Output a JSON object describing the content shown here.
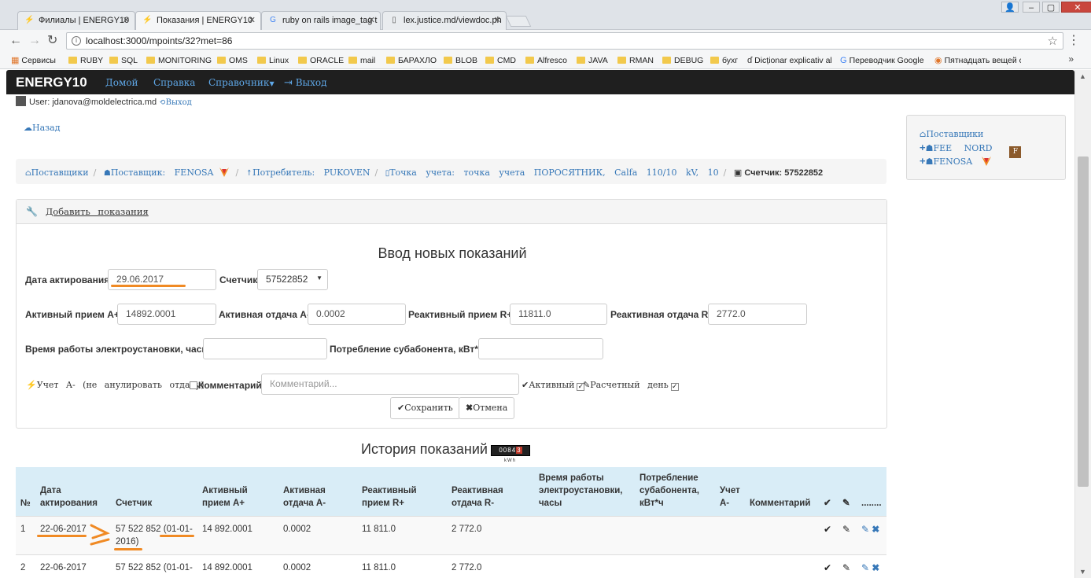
{
  "browser": {
    "tabs": [
      {
        "label": "Филиалы | ENERGY10",
        "active": false
      },
      {
        "label": "Показания | ENERGY10",
        "active": true
      },
      {
        "label": "ruby on rails image_tag t",
        "active": false
      },
      {
        "label": "lex.justice.md/viewdoc.ph",
        "active": false
      }
    ],
    "url": "localhost:3000/mpoints/32?met=86",
    "bookmarks": [
      "Сервисы",
      "RUBY",
      "SQL",
      "MONITORING",
      "OMS",
      "Linux",
      "ORACLE",
      "mail",
      "БАРАХЛО",
      "BLOB",
      "CMD",
      "Alfresco",
      "JAVA",
      "RMAN",
      "DEBUG",
      "бухг",
      "Dicționar explicativ al",
      "Переводчик Google",
      "Пятнадцать вещей с"
    ]
  },
  "navbar": {
    "brand": "ENERGY10",
    "links": [
      "Домой",
      "Справка",
      "Справочник",
      "Выход"
    ]
  },
  "user": {
    "label": "User: jdanova@moldelectrica.md",
    "logout": "Выход"
  },
  "back": "Назад",
  "breadcrumb": {
    "suppliers": "Поставщики",
    "supplier": "Поставщик: FENOSA",
    "consumer": "Потребитель: PUKOVEN",
    "point": "Точка учета: точка учета ПОРОСЯТНИК, Calfa 110/10 kV, 10",
    "meter": "Счетчик: 57522852"
  },
  "sidebar": {
    "title": "Поставщики",
    "items": [
      "FEE NORD",
      "FENOSA"
    ]
  },
  "form": {
    "heading": "Добавить показания",
    "title": "Ввод новых показаний",
    "date_label": "Дата актирования",
    "date_value": "29.06.2017",
    "meter_label": "Счетчик",
    "meter_value": "57522852",
    "active_in_label": "Активный прием A+",
    "active_in_value": "14892.0001",
    "active_out_label": "Активная отдача A-",
    "active_out_value": "0.0002",
    "reactive_in_label": "Реактивный прием R+",
    "reactive_in_value": "11811.0",
    "reactive_out_label": "Реактивная отдача R-",
    "reactive_out_value": "2772.0",
    "runtime_label": "Время работы электроустановки, часы",
    "runtime_value": "",
    "subconsumption_label": "Потребление субабонента, кВт*ч",
    "subconsumption_value": "",
    "account_label": "Учет A- (не анулировать отдачу)",
    "comment_label": "Комментарий",
    "comment_placeholder": "Комментарий...",
    "active_flag": "Активный",
    "settlement_flag": "Расчетный день",
    "save": "Сохранить",
    "cancel": "Отмена"
  },
  "history": {
    "title": "История показаний",
    "meter_icon": {
      "digits": "0084",
      "last": "3",
      "unit": "kWh"
    },
    "columns": [
      "№",
      "Дата актирования",
      "Счетчик",
      "Активный прием A+",
      "Активная отдача A-",
      "Реактивный прием R+",
      "Реактивная отдача R-",
      "Время работы электроустановки, часы",
      "Потребление субабонента, кВт*ч",
      "Учет A-",
      "Комментарий",
      "✔",
      "📌",
      "........"
    ],
    "rows": [
      {
        "n": "1",
        "date": "22-06-2017",
        "meter": "57 522 852 (01-01-2016)",
        "a_in": "14 892.0001",
        "a_out": "0.0002",
        "r_in": "11 811.0",
        "r_out": "2 772.0"
      },
      {
        "n": "2",
        "date": "22-06-2017",
        "meter": "57 522 852 (01-01-",
        "a_in": "14 892.0001",
        "a_out": "0.0002",
        "r_in": "11 811.0",
        "r_out": "2 772.0"
      }
    ]
  },
  "colors": {
    "accent": "#3778b8",
    "navbar": "#1f1f1f",
    "table_head": "#d9edf7",
    "annotation": "#f08a24"
  }
}
